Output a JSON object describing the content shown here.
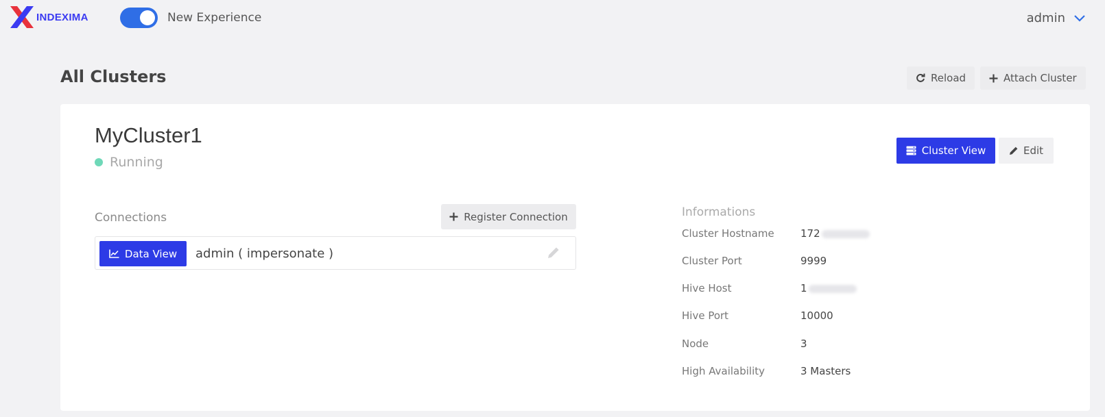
{
  "header": {
    "logo_text": "INDEXIMA",
    "toggle_label": "New Experience",
    "toggle_on": true,
    "user": "admin"
  },
  "page": {
    "title": "All Clusters",
    "reload_label": "Reload",
    "attach_label": "Attach Cluster"
  },
  "cluster": {
    "name": "MyCluster1",
    "status": "Running",
    "status_color": "#6fd8b8",
    "cluster_view_label": "Cluster View",
    "edit_label": "Edit"
  },
  "connections": {
    "title": "Connections",
    "register_label": "Register Connection",
    "items": [
      {
        "button_label": "Data View",
        "label": "admin ( impersonate )"
      }
    ]
  },
  "informations": {
    "title": "Informations",
    "rows": [
      {
        "key": "Cluster Hostname",
        "value": "172"
      },
      {
        "key": "Cluster Port",
        "value": "9999"
      },
      {
        "key": "Hive Host",
        "value": "1"
      },
      {
        "key": "Hive Port",
        "value": "10000"
      },
      {
        "key": "Node",
        "value": "3"
      },
      {
        "key": "High Availability",
        "value": "3 Masters"
      }
    ]
  },
  "colors": {
    "primary": "#2d3be6",
    "toggle": "#2f6ee6",
    "logo_red": "#e8323c",
    "logo_blue": "#3b3bf2"
  }
}
